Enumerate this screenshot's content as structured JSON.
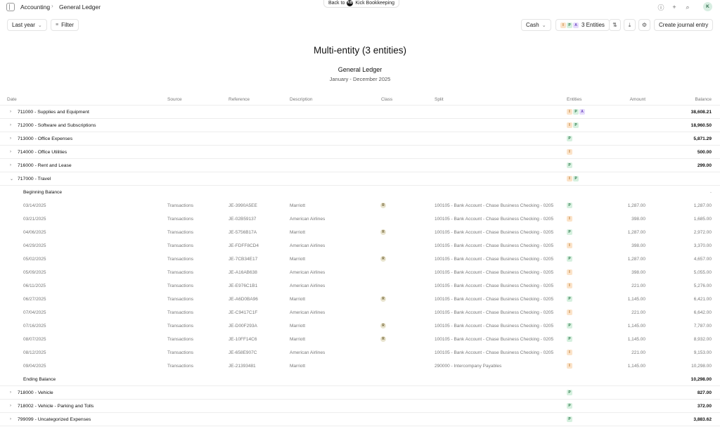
{
  "topbar": {
    "breadcrumb_root": "Accounting",
    "breadcrumb_current": "General Ledger",
    "back_prefix": "Back to",
    "back_logo": "KB",
    "back_target": "Kick Bookkeeping",
    "avatar_initial": "K",
    "icons": [
      "sidebar-toggle-icon",
      "info-icon",
      "plus-icon",
      "search-icon"
    ]
  },
  "toolbar": {
    "period_label": "Last year",
    "filter_label": "Filter",
    "basis_label": "Cash",
    "entities_label": "3 Entities",
    "entity_badges": [
      "I",
      "P",
      "A"
    ],
    "create_label": "Create journal entry"
  },
  "report": {
    "title": "Multi-entity (3 entities)",
    "subtitle": "General Ledger",
    "period": "January - December 2025"
  },
  "columns": {
    "date": "Date",
    "source": "Source",
    "reference": "Reference",
    "description": "Description",
    "class": "Class",
    "split": "Split",
    "entities": "Entities",
    "amount": "Amount",
    "balance": "Balance"
  },
  "accounts_top": [
    {
      "name": "711000 - Supplies and Equipment",
      "entities": [
        "I",
        "P",
        "A"
      ],
      "balance": "38,608.21"
    },
    {
      "name": "712000 - Software and Subscriptions",
      "entities": [
        "I",
        "P"
      ],
      "balance": "18,960.50"
    },
    {
      "name": "713000 - Office Expenses",
      "entities": [
        "P"
      ],
      "balance": "5,871.29"
    },
    {
      "name": "714000 - Office Utilities",
      "entities": [
        "I"
      ],
      "balance": "500.00"
    },
    {
      "name": "716000 - Rent and Lease",
      "entities": [
        "P"
      ],
      "balance": "299.00"
    },
    {
      "name": "717000 - Travel",
      "entities": [
        "I",
        "P"
      ],
      "balance": ""
    }
  ],
  "travel": {
    "beginning_label": "Beginning Balance",
    "beginning_value": "-",
    "ending_label": "Ending Balance",
    "ending_value": "10,298.00",
    "transactions": [
      {
        "date": "03/14/2025",
        "source": "Transactions",
        "ref": "JE-3990A5EE",
        "desc": "Marriott",
        "class": "R",
        "split": "100105 - Bank Account - Chase Business Checking - 0205",
        "entity": "P",
        "amount": "1,287.00",
        "balance": "1,287.00"
      },
      {
        "date": "03/21/2025",
        "source": "Transactions",
        "ref": "JE-02B59137",
        "desc": "American Airlines",
        "class": "",
        "split": "100105 - Bank Account - Chase Business Checking - 0205",
        "entity": "I",
        "amount": "398.00",
        "balance": "1,685.00"
      },
      {
        "date": "04/06/2025",
        "source": "Transactions",
        "ref": "JE-5756B17A",
        "desc": "Marriott",
        "class": "R",
        "split": "100105 - Bank Account - Chase Business Checking - 0205",
        "entity": "P",
        "amount": "1,287.00",
        "balance": "2,972.00"
      },
      {
        "date": "04/29/2025",
        "source": "Transactions",
        "ref": "JE-FDFF8CD4",
        "desc": "American Airlines",
        "class": "",
        "split": "100105 - Bank Account - Chase Business Checking - 0205",
        "entity": "I",
        "amount": "398.00",
        "balance": "3,370.00"
      },
      {
        "date": "05/02/2025",
        "source": "Transactions",
        "ref": "JE-7CB34E17",
        "desc": "Marriott",
        "class": "R",
        "split": "100105 - Bank Account - Chase Business Checking - 0205",
        "entity": "P",
        "amount": "1,287.00",
        "balance": "4,657.00"
      },
      {
        "date": "05/09/2025",
        "source": "Transactions",
        "ref": "JE-A16AB638",
        "desc": "American Airlines",
        "class": "",
        "split": "100105 - Bank Account - Chase Business Checking - 0205",
        "entity": "I",
        "amount": "398.00",
        "balance": "5,055.00"
      },
      {
        "date": "06/11/2025",
        "source": "Transactions",
        "ref": "JE-E976C1B1",
        "desc": "American Airlines",
        "class": "",
        "split": "100105 - Bank Account - Chase Business Checking - 0205",
        "entity": "I",
        "amount": "221.00",
        "balance": "5,276.00"
      },
      {
        "date": "06/27/2025",
        "source": "Transactions",
        "ref": "JE-A6D0BA96",
        "desc": "Marriott",
        "class": "R",
        "split": "100105 - Bank Account - Chase Business Checking - 0205",
        "entity": "P",
        "amount": "1,145.00",
        "balance": "6,421.00"
      },
      {
        "date": "07/04/2025",
        "source": "Transactions",
        "ref": "JE-C9417C1F",
        "desc": "American Airlines",
        "class": "",
        "split": "100105 - Bank Account - Chase Business Checking - 0205",
        "entity": "I",
        "amount": "221.00",
        "balance": "6,642.00"
      },
      {
        "date": "07/16/2025",
        "source": "Transactions",
        "ref": "JE-D00F293A",
        "desc": "Marriott",
        "class": "R",
        "split": "100105 - Bank Account - Chase Business Checking - 0205",
        "entity": "P",
        "amount": "1,145.00",
        "balance": "7,787.00"
      },
      {
        "date": "08/07/2025",
        "source": "Transactions",
        "ref": "JE-10FF14C6",
        "desc": "Marriott",
        "class": "R",
        "split": "100105 - Bank Account - Chase Business Checking - 0205",
        "entity": "P",
        "amount": "1,145.00",
        "balance": "8,932.00"
      },
      {
        "date": "08/12/2025",
        "source": "Transactions",
        "ref": "JE-658E907C",
        "desc": "American Airlines",
        "class": "",
        "split": "100105 - Bank Account - Chase Business Checking - 0205",
        "entity": "I",
        "amount": "221.00",
        "balance": "9,153.00"
      },
      {
        "date": "09/04/2025",
        "source": "Transactions",
        "ref": "JE-21393481",
        "desc": "Marriott",
        "class": "",
        "split": "290000 - Intercompany Payables",
        "entity": "I",
        "amount": "1,145.00",
        "balance": "10,298.00"
      }
    ]
  },
  "accounts_bottom": [
    {
      "name": "718000 - Vehicle",
      "entities": [
        "P"
      ],
      "balance": "827.00"
    },
    {
      "name": "718002 - Vehicle - Parking and Tolls",
      "entities": [
        "P"
      ],
      "balance": "372.00"
    },
    {
      "name": "799099 - Uncategorized Expenses",
      "entities": [
        "P"
      ],
      "balance": "3,883.62"
    }
  ]
}
